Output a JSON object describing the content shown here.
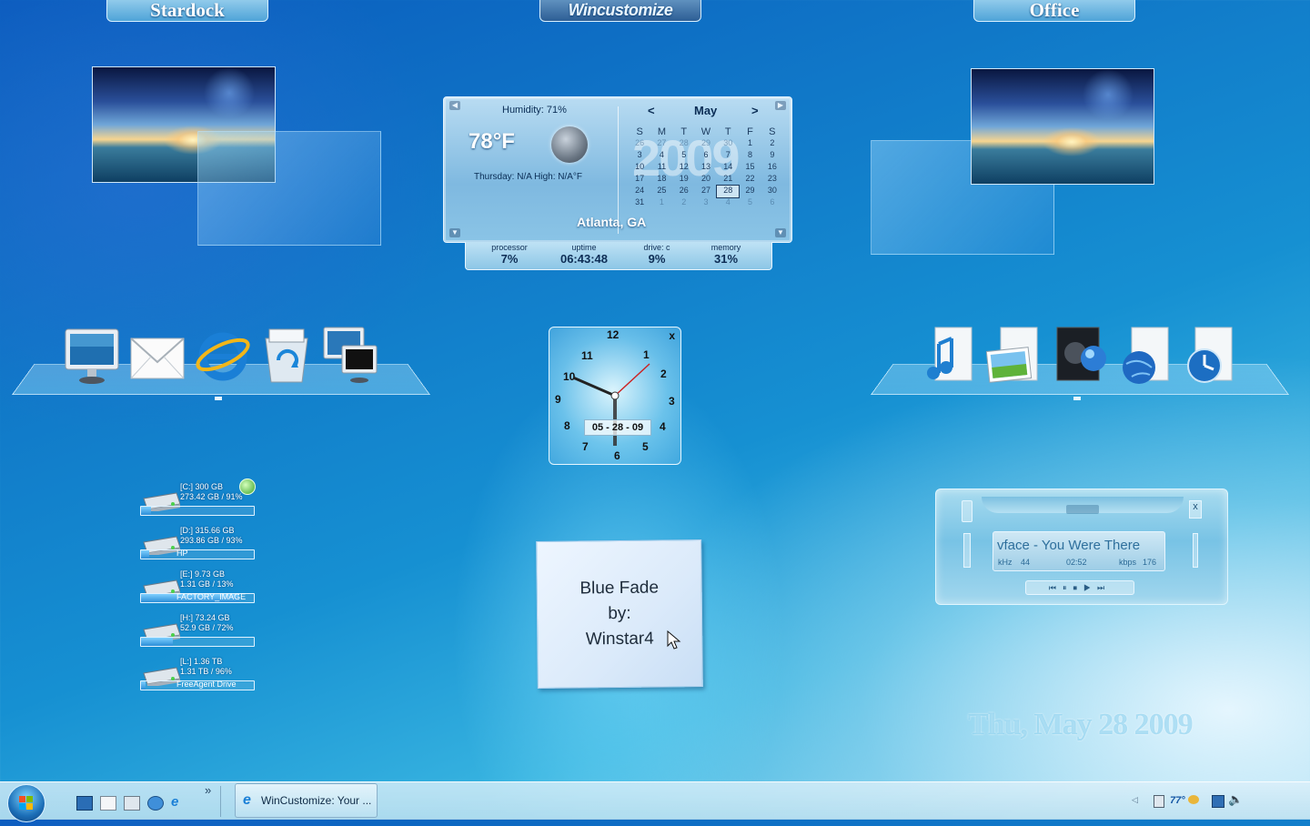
{
  "header": {
    "left_tab": "Stardock",
    "center_tab": "Wincustomize",
    "right_tab": "Office"
  },
  "weather": {
    "humidity": "Humidity: 71%",
    "temperature": "78°F",
    "forecast": "Thursday: N/A High: N/A°F",
    "location": "Atlanta, GA"
  },
  "calendar": {
    "prev": "<",
    "month": "May",
    "next": ">",
    "year": "2009",
    "weekdays": [
      "S",
      "M",
      "T",
      "W",
      "T",
      "F",
      "S"
    ],
    "weeks": [
      [
        "26",
        "27",
        "28",
        "29",
        "30",
        "1",
        "2"
      ],
      [
        "3",
        "4",
        "5",
        "6",
        "7",
        "8",
        "9"
      ],
      [
        "10",
        "11",
        "12",
        "13",
        "14",
        "15",
        "16"
      ],
      [
        "17",
        "18",
        "19",
        "20",
        "21",
        "22",
        "23"
      ],
      [
        "24",
        "25",
        "26",
        "27",
        "28",
        "29",
        "30"
      ],
      [
        "31",
        "1",
        "2",
        "3",
        "4",
        "5",
        "6"
      ]
    ],
    "today": "28"
  },
  "system": {
    "processor_label": "processor",
    "processor_value": "7%",
    "uptime_label": "uptime",
    "uptime_value": "06:43:48",
    "drive_label": "drive: c",
    "drive_value": "9%",
    "memory_label": "memory",
    "memory_value": "31%"
  },
  "clock": {
    "close": "x",
    "numbers": [
      "12",
      "1",
      "2",
      "3",
      "4",
      "5",
      "6",
      "7",
      "8",
      "9",
      "10",
      "11"
    ],
    "date": "05 - 28 - 09"
  },
  "drives": [
    {
      "line1": "[C:] 300 GB",
      "line2": "273.42 GB / 91%",
      "label": "",
      "used_fraction": 0.09
    },
    {
      "line1": "[D:] 315.66 GB",
      "line2": "293.86 GB / 93%",
      "label": "HP",
      "used_fraction": 0.07
    },
    {
      "line1": "[E:] 9.73 GB",
      "line2": "1.31 GB / 13%",
      "label": "FACTORY_IMAGE",
      "used_fraction": 0.87
    },
    {
      "line1": "[H:] 73.24 GB",
      "line2": "52.9 GB / 72%",
      "label": "",
      "used_fraction": 0.28
    },
    {
      "line1": "[L:] 1.36 TB",
      "line2": "1.31 TB / 96%",
      "label": "FreeAgent Drive",
      "used_fraction": 0.04
    }
  ],
  "note": {
    "line1": "Blue Fade",
    "line2": "by:",
    "line3": "Winstar4"
  },
  "player": {
    "track": "vface - You Were There",
    "khz_label": "kHz",
    "khz_value": "44",
    "time": "02:52",
    "kbps_label": "kbps",
    "kbps_value": "176",
    "close": "x"
  },
  "datestamp": "Thu, May 28 2009",
  "taskbar": {
    "task_title": "WinCustomize: Your ...",
    "overflow": "»",
    "tray_temp": "77°"
  },
  "colors": {
    "accent": "#1690d2",
    "panel_text": "#0a2d55"
  }
}
